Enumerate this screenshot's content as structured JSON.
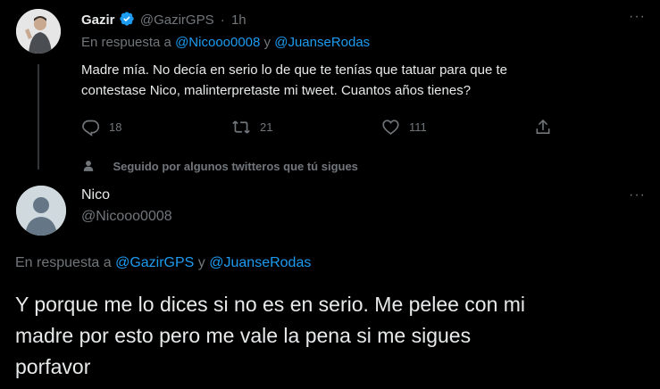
{
  "tweet1": {
    "author_name": "Gazir",
    "author_handle": "@GazirGPS",
    "separator": "·",
    "time": "1h",
    "reply_prefix": "En respuesta a",
    "reply_user1": "@Nicooo0008",
    "reply_conj": "y",
    "reply_user2": "@JuanseRodas",
    "text_line1": "Madre mía. No decía en serio lo de que te tenías que tatuar para que te",
    "text_line2": "contestase Nico, malinterpretaste mi tweet. Cuantos años tienes?",
    "replies": "18",
    "retweets": "21",
    "likes": "111"
  },
  "followed_note": "Seguido por algunos twitteros que tú sigues",
  "tweet2": {
    "author_name": "Nico",
    "author_handle": "@Nicooo0008",
    "reply_prefix": "En respuesta a",
    "reply_user1": "@GazirGPS",
    "reply_conj": "y",
    "reply_user2": "@JuanseRodas",
    "text_line1": "Y porque me lo dices si no es en serio. Me pelee con mi",
    "text_line2": "madre por esto pero me vale la pena si me sigues",
    "text_line3": "porfavor"
  },
  "colors": {
    "background": "#000000",
    "text": "#e7e9ea",
    "muted": "#71767b",
    "link": "#1d9bf0",
    "verified": "#1d9bf0"
  }
}
